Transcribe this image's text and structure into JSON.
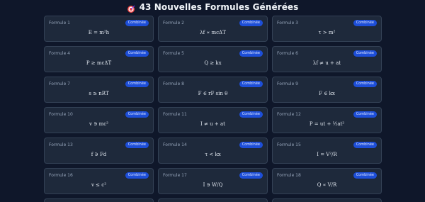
{
  "header": {
    "title": "43 Nouvelles Formules Générées",
    "icon": "target-icon"
  },
  "colors": {
    "background": "#0f172a",
    "card": "#1e293b",
    "badge": "#1d4ed8"
  },
  "cards": [
    {
      "label": "Formule 1",
      "badge": "Combinée",
      "formula": "E = m²h"
    },
    {
      "label": "Formule 2",
      "badge": "Combinée",
      "formula": "λf ∝ mcΔT"
    },
    {
      "label": "Formule 3",
      "badge": "Combinée",
      "formula": "τ > m²"
    },
    {
      "label": "Formule 4",
      "badge": "Combinée",
      "formula": "P ≥ mcΔT"
    },
    {
      "label": "Formule 5",
      "badge": "Combinée",
      "formula": "Q ≥ kx"
    },
    {
      "label": "Formule 6",
      "badge": "Combinée",
      "formula": "λf ≠ u + at"
    },
    {
      "label": "Formule 7",
      "badge": "Combinée",
      "formula": "s ≥ nRT"
    },
    {
      "label": "Formule 8",
      "badge": "Combinée",
      "formula": "F ∈ rF sin θ"
    },
    {
      "label": "Formule 9",
      "badge": "Combinée",
      "formula": "F ∈ kx"
    },
    {
      "label": "Formule 10",
      "badge": "Combinée",
      "formula": "v ∋ mc²"
    },
    {
      "label": "Formule 11",
      "badge": "Combinée",
      "formula": "I ≠ u + at"
    },
    {
      "label": "Formule 12",
      "badge": "Combinée",
      "formula": "P = ut + ½at²"
    },
    {
      "label": "Formule 13",
      "badge": "Combinée",
      "formula": "f ∋ Fd"
    },
    {
      "label": "Formule 14",
      "badge": "Combinée",
      "formula": "τ < kx"
    },
    {
      "label": "Formule 15",
      "badge": "Combinée",
      "formula": "I = V²/R"
    },
    {
      "label": "Formule 16",
      "badge": "Combinée",
      "formula": "v ≤ c²"
    },
    {
      "label": "Formule 17",
      "badge": "Combinée",
      "formula": "I ∋ W/Q"
    },
    {
      "label": "Formule 18",
      "badge": "Combinée",
      "formula": "Q ∝ V/R"
    }
  ]
}
